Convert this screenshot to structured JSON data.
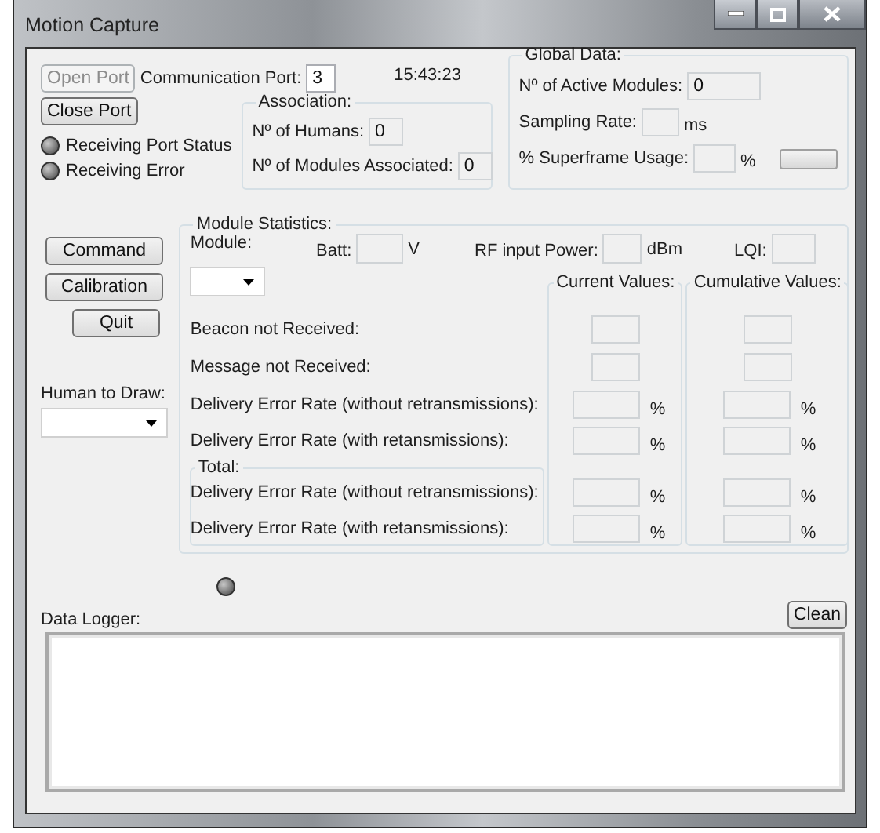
{
  "window": {
    "title": "Motion Capture"
  },
  "port": {
    "open_button": {
      "label": "Open Port",
      "disabled": true
    },
    "close_button": {
      "label": "Close Port",
      "disabled": false
    },
    "label": "Communication Port:",
    "value": "3",
    "time": "15:43:23"
  },
  "indicators": [
    {
      "label": "Receiving Port Status",
      "on": false
    },
    {
      "label": "Receiving Error",
      "on": false
    }
  ],
  "association": {
    "title": "Association:",
    "fields": [
      {
        "label": "Nº of Humans:",
        "value": "0"
      },
      {
        "label": "Nº of Modules Associated:",
        "value": "0"
      }
    ]
  },
  "global_data": {
    "title": "Global Data:",
    "active_label": "Nº of Active Modules:",
    "active_value": "0",
    "sampling_label": "Sampling Rate:",
    "sampling_unit": "ms",
    "usage_label": "% Superframe Usage:",
    "usage_unit": "%",
    "usage_level": {
      "level": 0
    }
  },
  "actions": [
    {
      "label": "Command"
    },
    {
      "label": "Calibration"
    },
    {
      "label": "Quit"
    }
  ],
  "human_to_draw": {
    "label": "Human to Draw:"
  },
  "module_statistics": {
    "title": "Module Statistics:",
    "module_label": "Module:",
    "batt_label": "Batt:",
    "batt_unit": "V",
    "rf_label": "RF input Power:",
    "rf_unit": "dBm",
    "lqi_label": "LQI:",
    "current_title": "Current Values:",
    "cumulative_title": "Cumulative Values:",
    "rows": [
      {
        "label": "Beacon not Received:"
      },
      {
        "label": "Message not Received:"
      },
      {
        "label": "Delivery Error Rate (without retransmissions):",
        "current_unit": "%",
        "cumulative_unit": "%"
      },
      {
        "label": "Delivery Error Rate (with retansmissions):",
        "current_unit": "%",
        "cumulative_unit": "%"
      }
    ],
    "total_title": "Total:",
    "total_rows": [
      {
        "label": "Delivery Error Rate (without retransmissions):",
        "current_unit": "%",
        "cumulative_unit": "%"
      },
      {
        "label": "Delivery Error Rate (with retansmissions):",
        "current_unit": "%",
        "cumulative_unit": "%"
      }
    ]
  },
  "logger": {
    "indicator_on": false,
    "label": "Data Logger:",
    "clean_button": "Clean"
  }
}
